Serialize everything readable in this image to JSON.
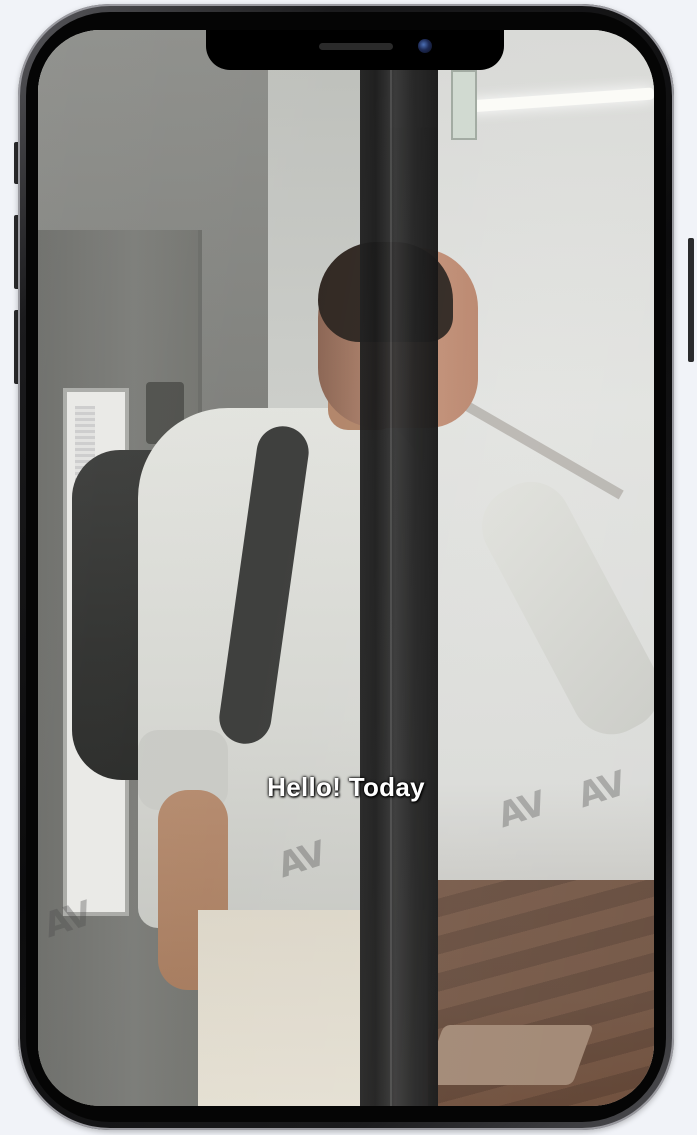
{
  "video": {
    "caption": "Hello! Today"
  },
  "device": {
    "model": "smartphone",
    "frame_color": "#0c0c0d",
    "background_color": "#f1f3f8"
  },
  "scene": {
    "wall_logo": "AV"
  }
}
